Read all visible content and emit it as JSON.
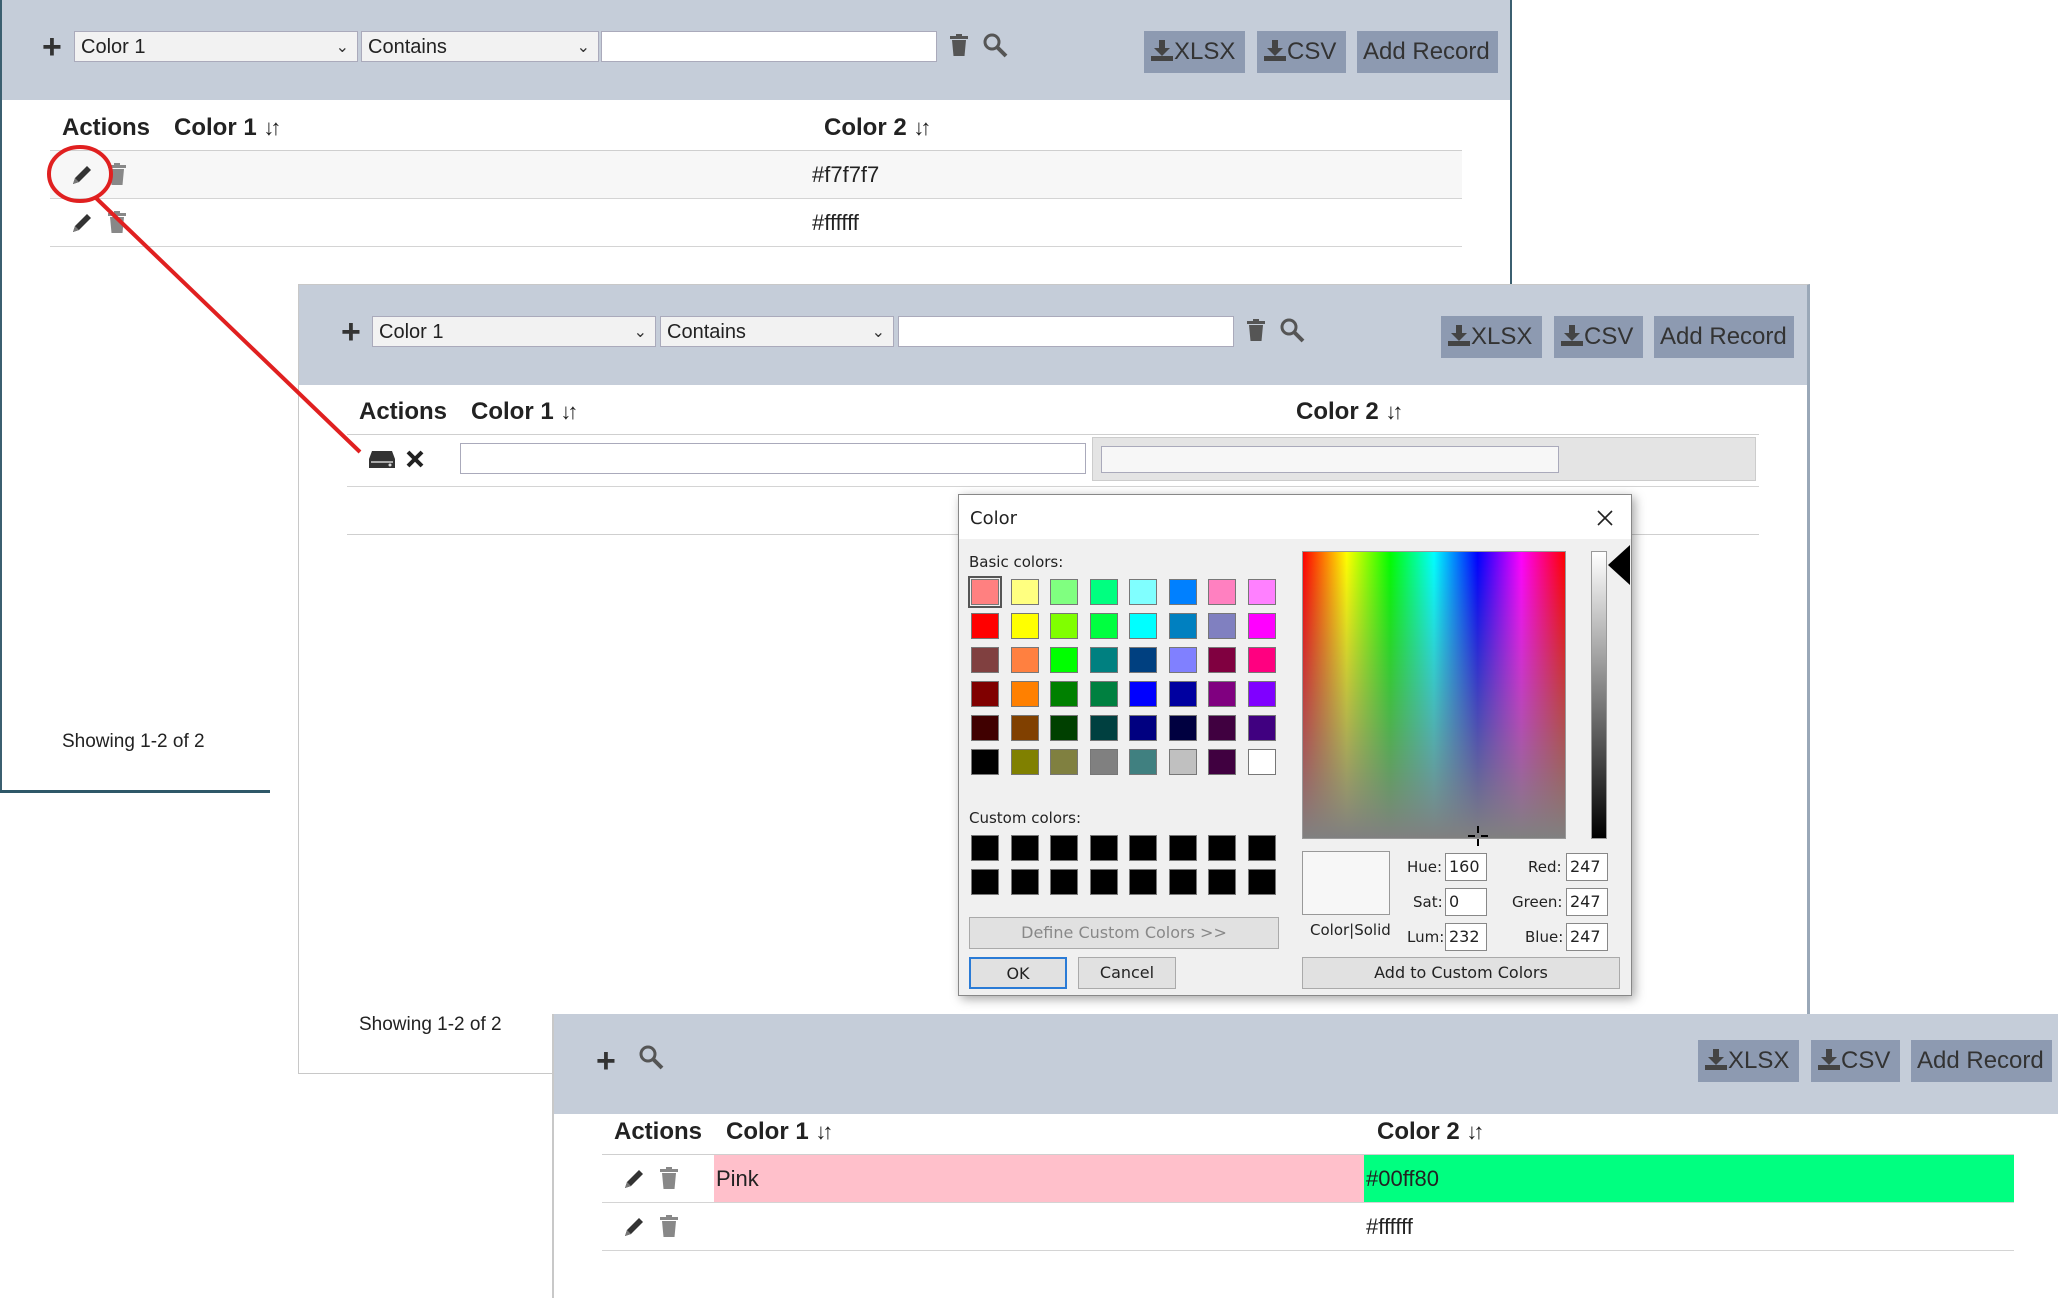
{
  "toolbar": {
    "column_select": "Color 1",
    "operator_select": "Contains",
    "filter_value": "",
    "xlsx_label": "XLSX",
    "csv_label": "CSV",
    "add_record_label": "Add Record"
  },
  "table": {
    "columns": [
      "Actions",
      "Color 1",
      "Color 2"
    ],
    "sort_glyph": "↓↑"
  },
  "panel1": {
    "rows": [
      {
        "color1": "",
        "color2": "#f7f7f7"
      },
      {
        "color1": "",
        "color2": "#ffffff"
      }
    ],
    "showing": "Showing 1-2 of 2"
  },
  "panel2": {
    "edit_row": {
      "color1_value": "",
      "color2_value": ""
    },
    "showing": "Showing 1-2 of 2"
  },
  "panel3": {
    "rows": [
      {
        "color1": "Pink",
        "color2": "#00ff80",
        "color1_bg": "#ffc0cb",
        "color2_bg": "#00ff80"
      },
      {
        "color1": "",
        "color2": "#ffffff",
        "color1_bg": "",
        "color2_bg": ""
      }
    ]
  },
  "color_dialog": {
    "title": "Color",
    "basic_colors_label": "Basic colors:",
    "custom_colors_label": "Custom colors:",
    "define_custom_label": "Define Custom Colors >>",
    "ok_label": "OK",
    "cancel_label": "Cancel",
    "add_custom_label": "Add to Custom Colors",
    "color_solid_label": "Color|Solid",
    "hue_label": "Hue:",
    "sat_label": "Sat:",
    "lum_label": "Lum:",
    "red_label": "Red:",
    "green_label": "Green:",
    "blue_label": "Blue:",
    "hue": "160",
    "sat": "0",
    "lum": "232",
    "red": "247",
    "green": "247",
    "blue": "247",
    "basic_colors": [
      "#ff8080",
      "#ffff80",
      "#80ff80",
      "#00ff80",
      "#80ffff",
      "#0080ff",
      "#ff80c0",
      "#ff80ff",
      "#ff0000",
      "#ffff00",
      "#80ff00",
      "#00ff40",
      "#00ffff",
      "#0080c0",
      "#8080c0",
      "#ff00ff",
      "#804040",
      "#ff8040",
      "#00ff00",
      "#008080",
      "#004080",
      "#8080ff",
      "#800040",
      "#ff0080",
      "#800000",
      "#ff8000",
      "#008000",
      "#008040",
      "#0000ff",
      "#0000a0",
      "#800080",
      "#8000ff",
      "#400000",
      "#804000",
      "#004000",
      "#004040",
      "#000080",
      "#000040",
      "#400040",
      "#400080",
      "#000000",
      "#808000",
      "#808040",
      "#808080",
      "#408080",
      "#c0c0c0",
      "#400040",
      "#ffffff"
    ],
    "custom_colors": [
      "#000000",
      "#000000",
      "#000000",
      "#000000",
      "#000000",
      "#000000",
      "#000000",
      "#000000",
      "#000000",
      "#000000",
      "#000000",
      "#000000",
      "#000000",
      "#000000",
      "#000000",
      "#000000"
    ],
    "current_color": "#f7f7f7"
  },
  "colors": {
    "toolbar_bg": "#c5cdd9",
    "button_bg": "#8d9ab1",
    "annotation": "#e02020"
  }
}
